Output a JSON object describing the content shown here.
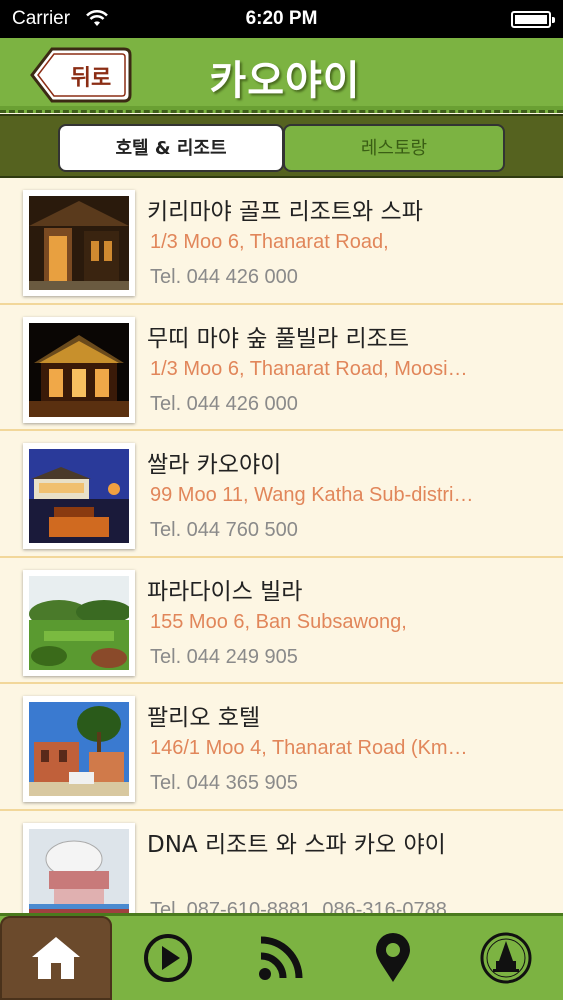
{
  "status_bar": {
    "carrier": "Carrier",
    "time": "6:20 PM"
  },
  "navbar": {
    "back_label": "뒤로",
    "title": "카오야이"
  },
  "segments": [
    {
      "label": "호텔 & 리조트",
      "selected": true
    },
    {
      "label": "레스토랑",
      "selected": false
    }
  ],
  "items": [
    {
      "name": "키리마야 골프 리조트와 스파",
      "address": "1/3 Moo 6, Thanarat Road,",
      "tel": "Tel. 044 426 000",
      "image": "resort-building-photo"
    },
    {
      "name": "무띠 마야 숲 풀빌라 리조트",
      "address": "1/3 Moo 6, Thanarat Road, Moosi…",
      "tel": "Tel. 044 426 000",
      "image": "night-pavilion-photo"
    },
    {
      "name": "쌀라 카오야이",
      "address": "99 Moo 11, Wang Katha Sub-distri…",
      "tel": "Tel. 044 760 500",
      "image": "dusk-terrace-photo"
    },
    {
      "name": "파라다이스 빌라",
      "address": "155 Moo 6, Ban Subsawong,",
      "tel": "Tel. 044 249 905",
      "image": "garden-photo"
    },
    {
      "name": "팔리오 호텔",
      "address": "146/1 Moo 4, Thanarat Road (Km…",
      "tel": "Tel. 044 365 905",
      "image": "italian-style-building-photo"
    },
    {
      "name": "DNA 리조트 와 스파 카오 야이",
      "address": "",
      "tel": "Tel. 087-610-8881, 086-316-0788",
      "image": "dome-building-photo"
    }
  ],
  "tabbar": {
    "tabs": [
      "home-icon",
      "play-icon",
      "rss-icon",
      "location-pin-icon",
      "tourism-logo-icon"
    ],
    "active": "home-icon"
  },
  "colors": {
    "green": "#7cb342",
    "dark_olive": "#55621f",
    "address_orange": "#e1865a",
    "tel_gray": "#8a8a8a",
    "active_tab_brown": "#6b4a2c"
  }
}
